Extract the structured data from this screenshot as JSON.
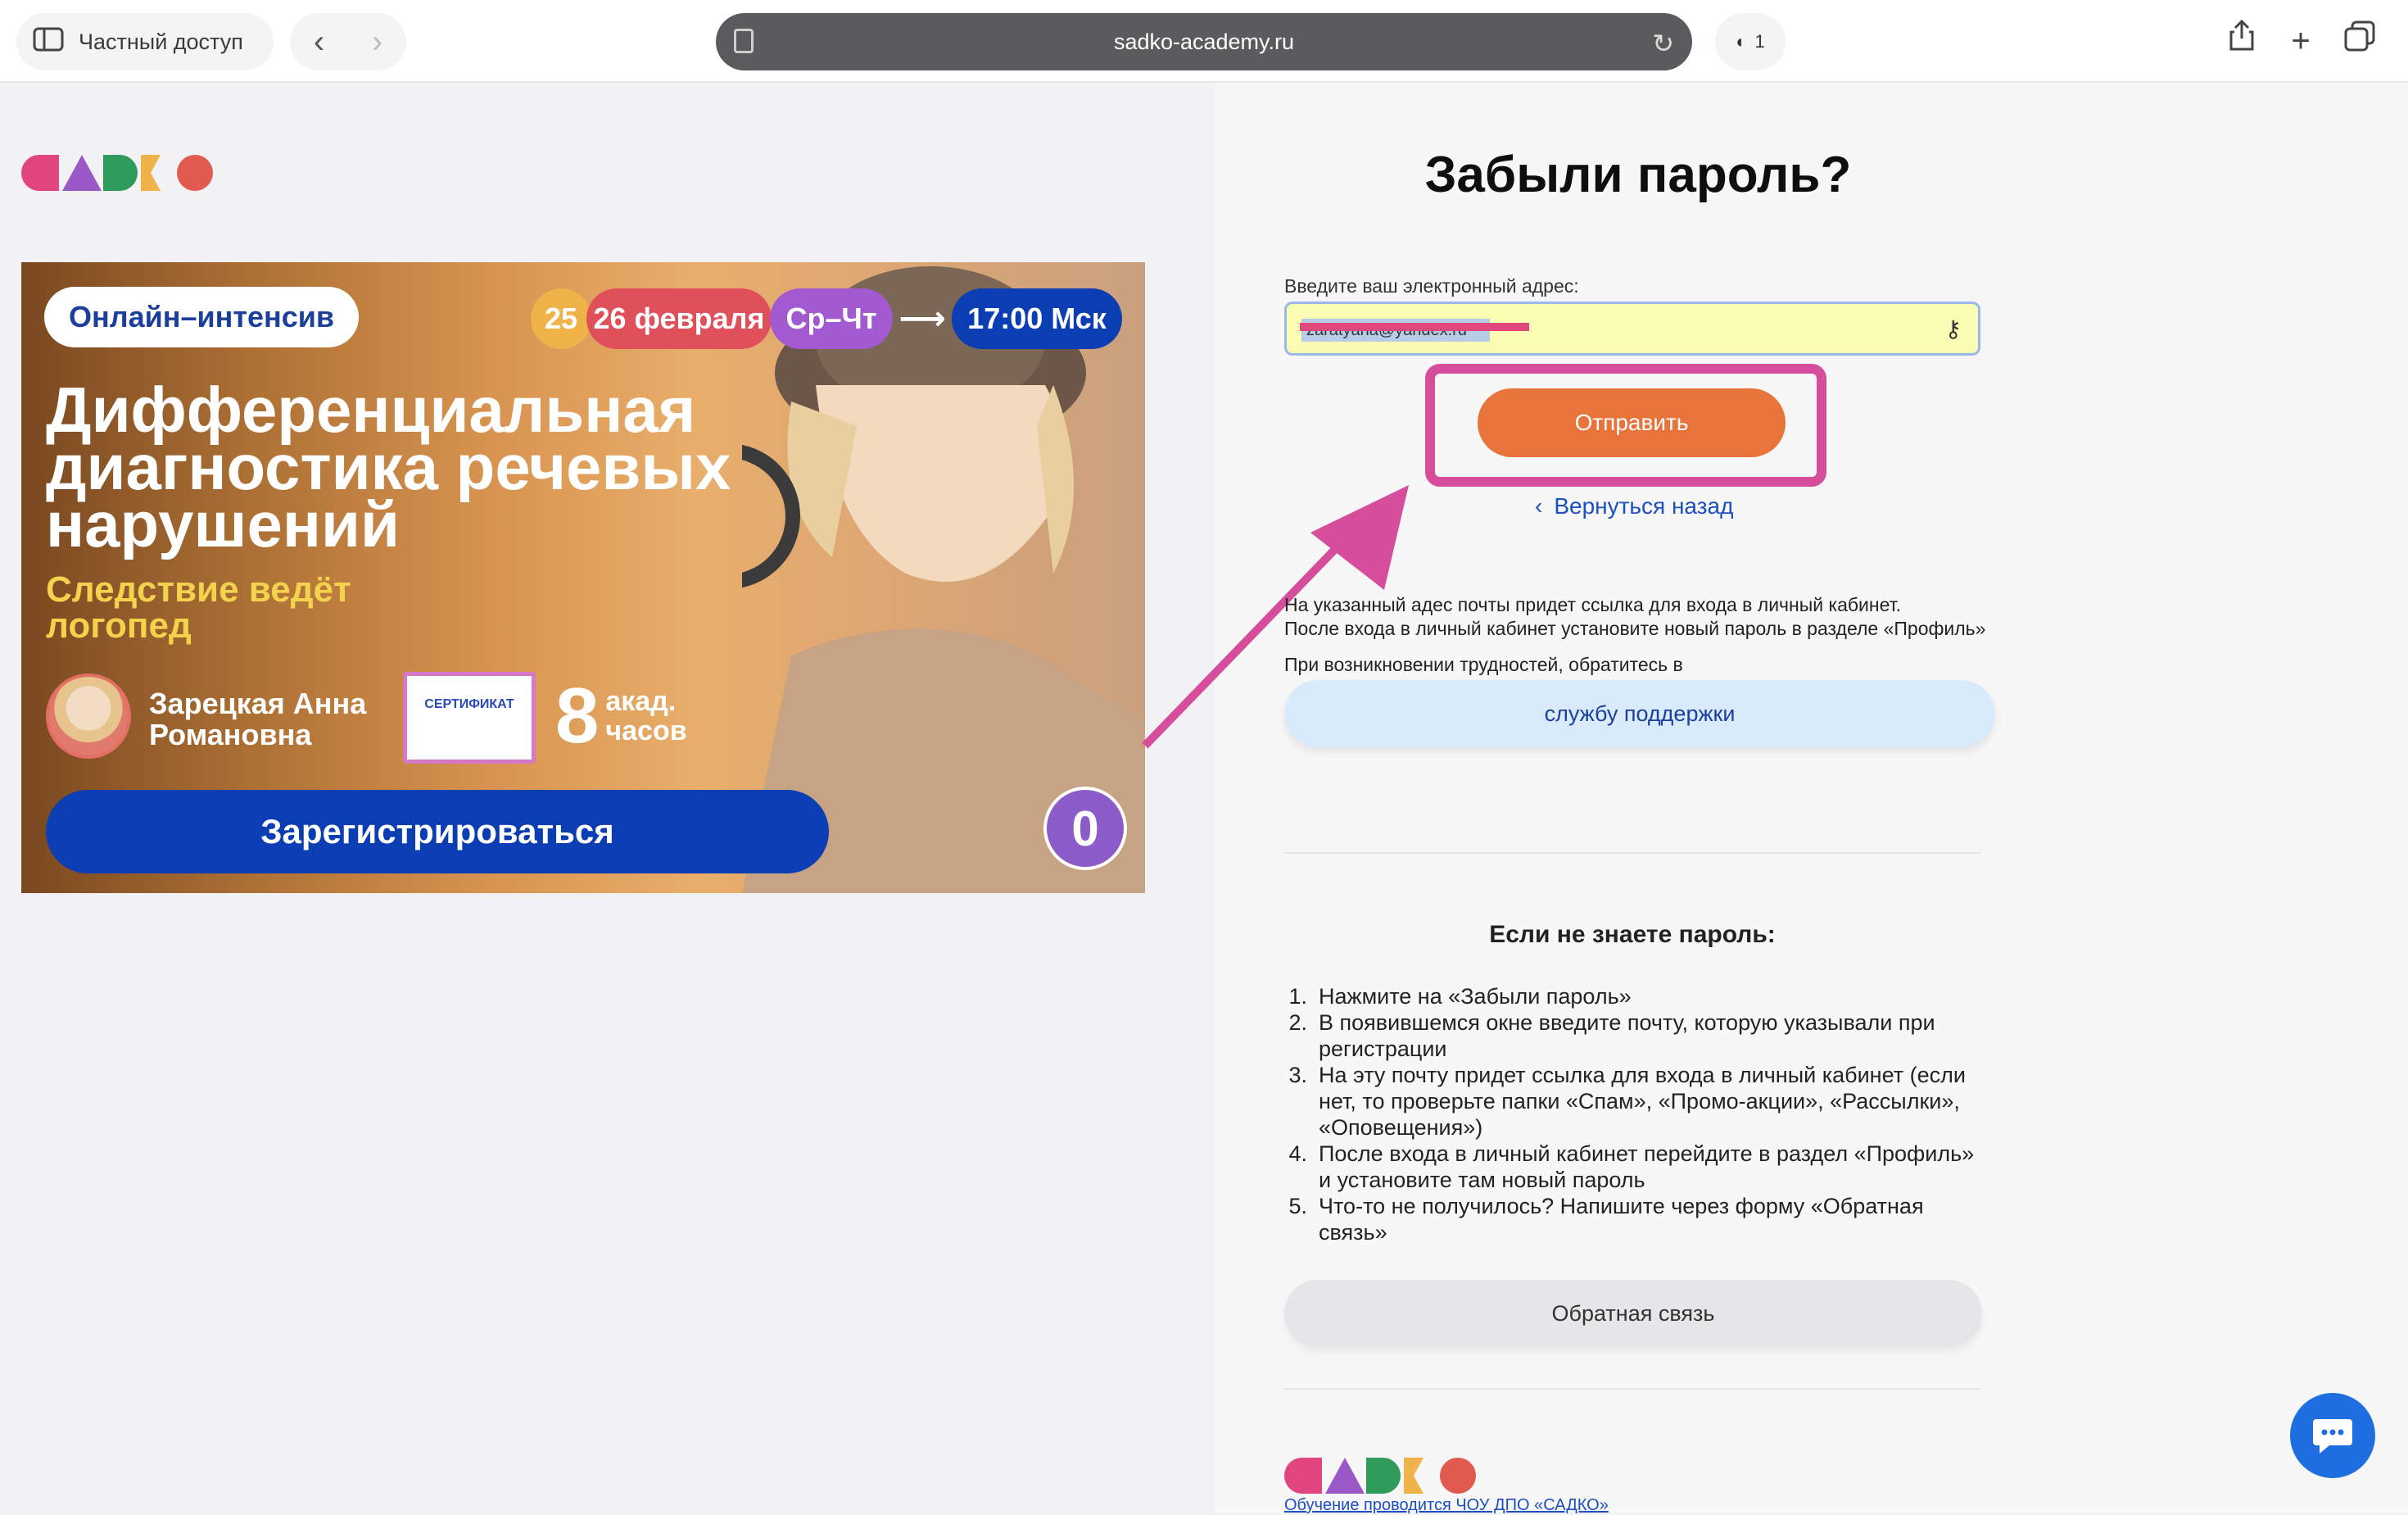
{
  "browser": {
    "private_label": "Частный доступ",
    "url": "sadko-academy.ru",
    "shield_count": "1"
  },
  "banner": {
    "tag_online": "Онлайн–интенсив",
    "date_a": "25",
    "date_b": "26 февраля",
    "days": "Ср–Чт",
    "arrow": "⟶",
    "time": "17:00 Мск",
    "headline": "Дифференциальная диагностика речевых нарушений",
    "subhead": "Следствие ведёт логопед",
    "speaker": "Зарецкая Анна Романовна",
    "certificate": "СЕРТИФИКАТ",
    "hours_num": "8",
    "hours_label": "акад. часов",
    "register": "Зарегистрироваться",
    "free_num": "0"
  },
  "form": {
    "title": "Забыли пароль?",
    "email_label": "Введите ваш электронный адрес:",
    "email_value": "zaratyana@yandex.ru",
    "submit": "Отправить",
    "back": "Вернуться назад",
    "info_line1": "На указанный адес почты придет ссылка для входа в личный кабинет.",
    "info_line2": "После входа в личный кабинет установите новый пароль в разделе «Профиль»",
    "trouble": "При возникновении трудностей, обратитесь в",
    "support": "службу поддержки"
  },
  "help": {
    "title": "Если не знаете пароль:",
    "steps": [
      "Нажмите на «Забыли пароль»",
      "В появившемся окне введите почту, которую указывали при регистрации",
      "На эту почту придет ссылка для входа в личный кабинет (если нет, то проверьте папки «Спам», «Промо-акции», «Рассылки», «Оповещения»)",
      "После входа в личный кабинет перейдите в раздел «Профиль» и установите там новый пароль",
      "Что-то не получилось? Напишите через форму «Обратная связь»"
    ],
    "feedback": "Обратная связь"
  },
  "footer": {
    "text": "Обучение проводится ЧОУ ДПО «САДКО»"
  },
  "colors": {
    "accent_orange": "#e8743b",
    "highlight_pink": "#d64d9c",
    "brand_blue": "#0b3db3"
  }
}
